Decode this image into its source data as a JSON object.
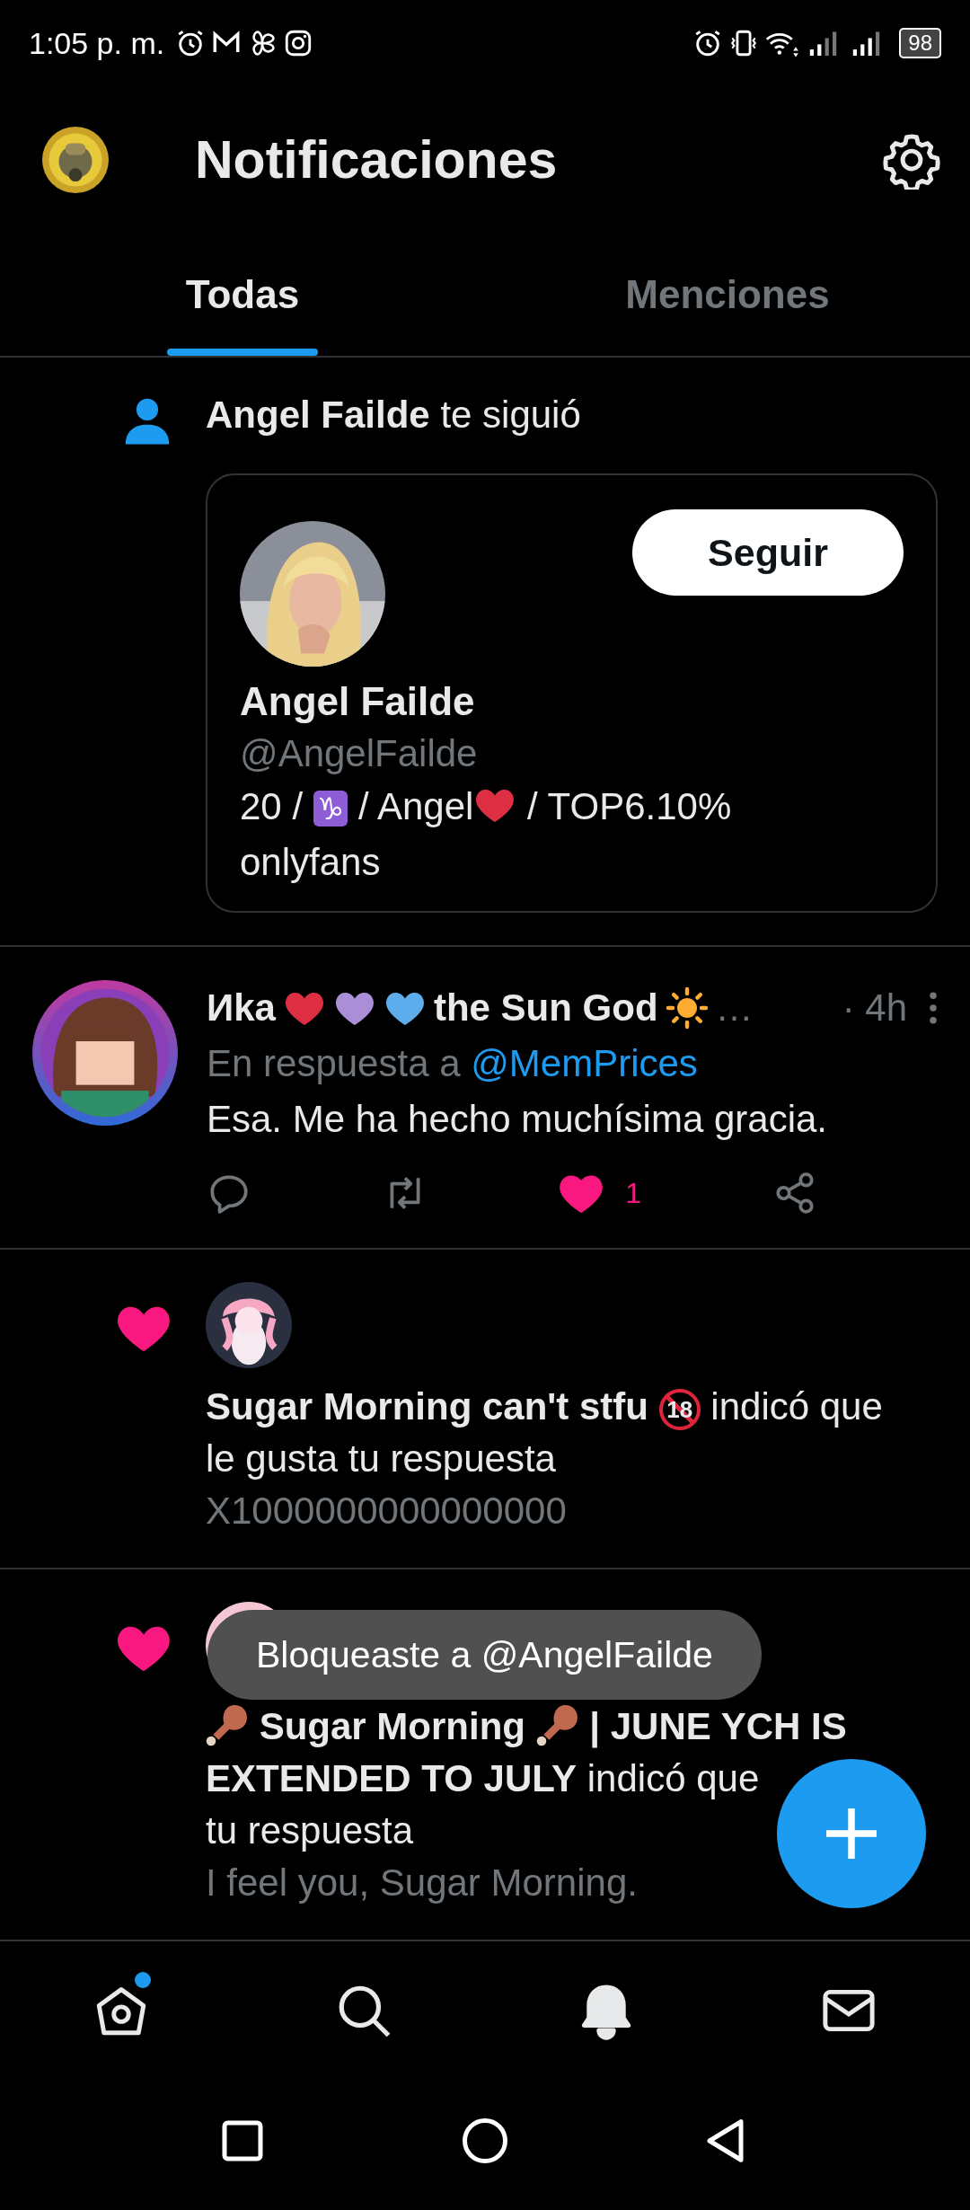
{
  "status_bar": {
    "time": "1:05 p. m.",
    "battery": "98"
  },
  "header": {
    "title": "Notificaciones"
  },
  "tabs": [
    {
      "label": "Todas",
      "selected": true
    },
    {
      "label": "Menciones",
      "selected": false
    }
  ],
  "notifications": [
    {
      "kind": "follow",
      "actor": "Angel Failde",
      "action": "te siguió",
      "card": {
        "name": "Angel Failde",
        "handle": "@AngelFailde",
        "button": "Seguir",
        "bio": [
          {
            "kind": "text",
            "text": "20 / "
          },
          {
            "kind": "sign",
            "text": "♑"
          },
          {
            "kind": "text",
            "text": " / Angel"
          },
          {
            "kind": "heart",
            "color": "#dd2e44"
          },
          {
            "kind": "text",
            "text": " / TOP6.10%"
          },
          {
            "kind": "break"
          },
          {
            "kind": "text",
            "text": "onlyfans"
          }
        ]
      }
    },
    {
      "kind": "reply",
      "name_parts": [
        {
          "kind": "text",
          "text": "Иka"
        },
        {
          "kind": "heart",
          "color": "#dd2e44"
        },
        {
          "kind": "heart",
          "color": "#aa8ed6"
        },
        {
          "kind": "heart",
          "color": "#5dadec"
        },
        {
          "kind": "text",
          "text": "the Sun God"
        },
        {
          "kind": "sun"
        },
        {
          "kind": "muted",
          "text": "…"
        }
      ],
      "time": "· 4h",
      "reply_prefix": "En respuesta a",
      "reply_to": "@MemPrices",
      "text": "Esa. Me ha hecho muchísima gracia.",
      "liked": true,
      "likes": "1"
    },
    {
      "kind": "like",
      "actor_parts": [
        {
          "kind": "text",
          "text": "Sugar Morning can't stfu"
        },
        {
          "kind": "no18",
          "text": "18"
        }
      ],
      "action_parts": [
        "indicó que",
        "le gusta tu respuesta"
      ],
      "quote": "X1000000000000000"
    },
    {
      "kind": "like",
      "actor_parts": [
        {
          "kind": "drumstick"
        },
        {
          "kind": "text",
          "text": "Sugar Morning"
        },
        {
          "kind": "drumstick"
        },
        {
          "kind": "text",
          "text": "| JUNE YCH IS"
        },
        {
          "kind": "text",
          "text": "EXTENDED TO JULY"
        }
      ],
      "action_parts": [
        "indicó que",
        "tu respuesta"
      ],
      "quote": "I feel you, Sugar Morning."
    }
  ],
  "toast": "Bloqueaste a @AngelFailde",
  "bottom_nav": [
    {
      "kind": "home",
      "selected": false,
      "has_new": true
    },
    {
      "kind": "search",
      "selected": false,
      "has_new": false
    },
    {
      "kind": "bell",
      "selected": true,
      "has_new": false
    },
    {
      "kind": "mail",
      "selected": false,
      "has_new": false
    }
  ]
}
